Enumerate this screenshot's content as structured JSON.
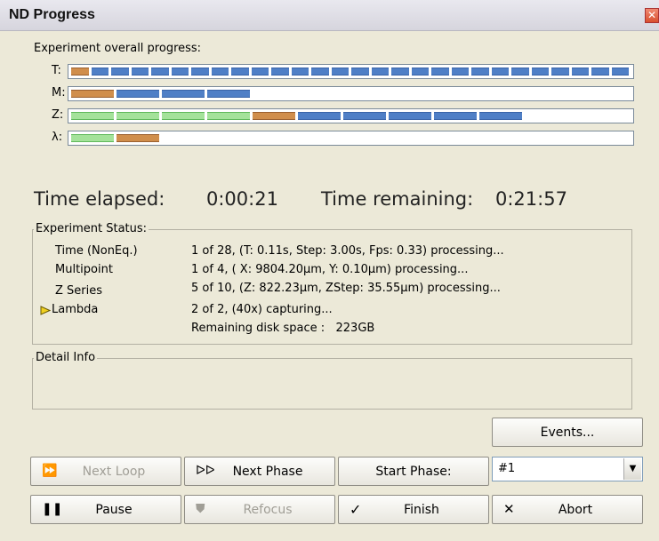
{
  "window": {
    "title": "ND Progress",
    "close_label": "✕"
  },
  "progress": {
    "heading": "Experiment overall progress:",
    "rows": [
      {
        "label": "T:",
        "done": 0,
        "current": 1,
        "total": 28
      },
      {
        "label": "M:",
        "done": 0,
        "current": 1,
        "total": 4
      },
      {
        "label": "Z:",
        "done": 4,
        "current": 1,
        "total": 10
      },
      {
        "label": "λ:",
        "done": 1,
        "current": 1,
        "total": 2
      }
    ]
  },
  "time": {
    "elapsed_label": "Time elapsed:",
    "elapsed": "0:00:21",
    "remaining_label": "Time remaining:",
    "remaining": "0:21:57"
  },
  "status": {
    "label": "Experiment Status:",
    "rows": [
      {
        "name": "Time (NonEq.)",
        "detail": "1 of 28, (T: 0.11s, Step: 3.00s, Fps: 0.33) processing..."
      },
      {
        "name": "Multipoint",
        "detail": "1 of 4, ( X: 9804.20µm, Y: 0.10µm) processing..."
      },
      {
        "name": "Z Series",
        "detail": "5 of 10, (Z: 822.23µm, ZStep: 35.55µm) processing..."
      },
      {
        "name": "Lambda",
        "detail": "2 of 2, (40x) capturing..."
      }
    ],
    "disk_space": "Remaining disk space :   223GB"
  },
  "detail_info": {
    "label": "Detail Info"
  },
  "buttons": {
    "events": "Events...",
    "next_loop": "Next Loop",
    "next_phase": "Next Phase",
    "start_phase": "Start Phase:",
    "pause": "Pause",
    "refocus": "Refocus",
    "finish": "Finish",
    "abort": "Abort"
  },
  "phase_select": {
    "value": "#1"
  },
  "colors": {
    "done": "#a4e29a",
    "current": "#d08e4c",
    "pending": "#4f7fc6",
    "active_marker": "#f0d020"
  }
}
